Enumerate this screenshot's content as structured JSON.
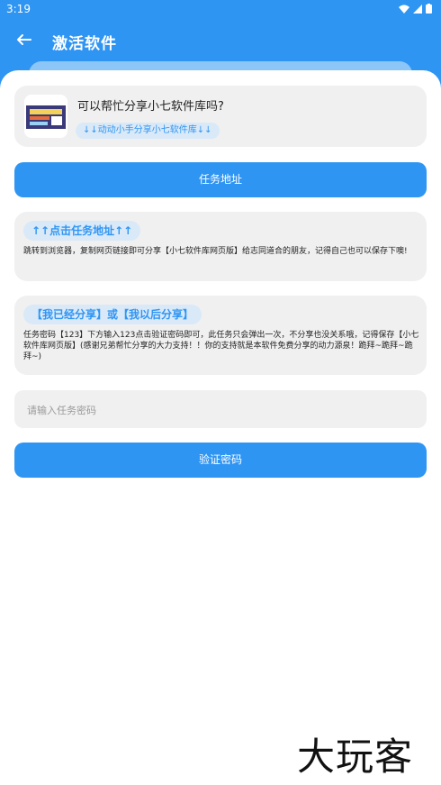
{
  "status": {
    "time": "3:19"
  },
  "appbar": {
    "title": "激活软件"
  },
  "share_card": {
    "title": "可以帮忙分享小七软件库吗?",
    "pill": "↓↓动动小手分享小七软件库↓↓"
  },
  "buttons": {
    "task": "任务地址",
    "verify": "验证密码"
  },
  "info1": {
    "heading": "↑↑点击任务地址↑↑",
    "text": "跳转到浏览器，复制网页链接即可分享【小七软件库网页版】给志同道合的朋友，记得自己也可以保存下噢!"
  },
  "info2": {
    "heading": "【我已经分享】或【我以后分享】",
    "text": "任务密码【123】下方输入123点击验证密码即可，此任务只会弹出一次，不分享也没关系哦，记得保存【小七软件库网页版】(感谢兄弟帮忙分享的大力支持！！你的支持就是本软件免费分享的动力源泉！跪拜~跪拜~跪拜~)"
  },
  "input": {
    "placeholder": "请输入任务密码"
  },
  "watermark": "大玩客",
  "colors": {
    "primary": "#2f95f3",
    "card": "#f0f0f0",
    "pill": "#d9e9f8"
  }
}
